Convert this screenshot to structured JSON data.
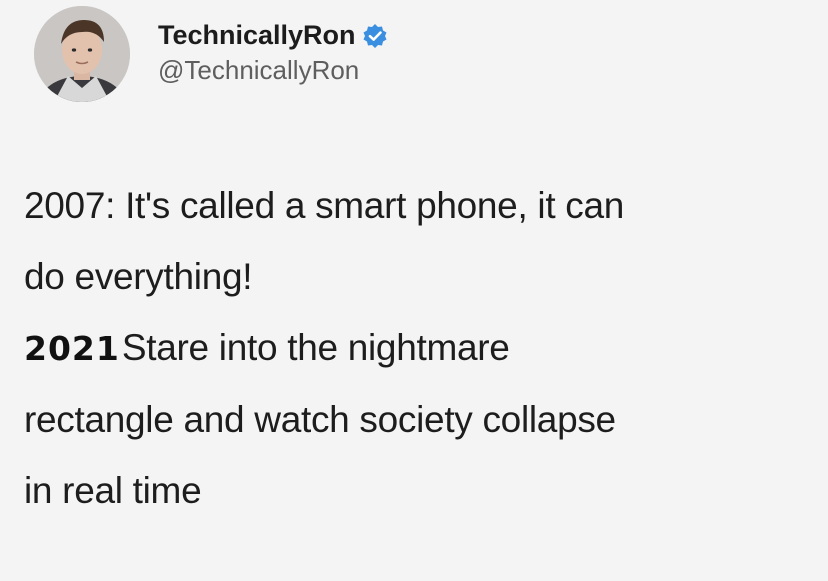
{
  "author": {
    "display_name": "TechnicallyRon",
    "handle": "@TechnicallyRon",
    "verified": true,
    "avatar_icon": "profile-photo"
  },
  "tweet": {
    "line1": "2007: It's called a smart phone, it can",
    "line2": "do everything!",
    "line3_year": "2021",
    "line3_rest": "Stare into the nightmare",
    "line4": "rectangle and watch society collapse",
    "line5": "in real time"
  },
  "colors": {
    "background": "#f4f4f4",
    "verified_badge": "#3b8fe0",
    "text": "#1d1d1d",
    "handle": "#5e5e5e"
  }
}
